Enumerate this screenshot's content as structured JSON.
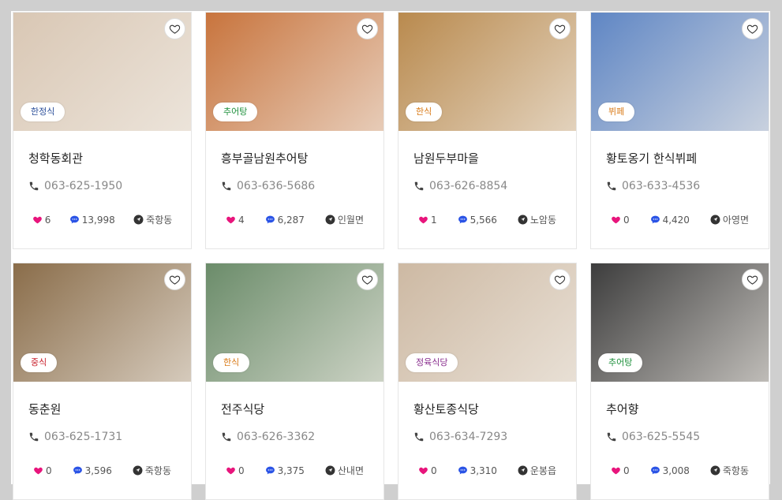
{
  "colors": {
    "heart": "#e8157c",
    "comment": "#2b54e6",
    "location": "#333333"
  },
  "icons": {
    "favorite": "heart-outline-icon",
    "phone": "phone-icon",
    "likes": "heart-icon",
    "comments": "chat-bubble-icon",
    "location": "location-arrow-icon"
  },
  "restaurants": [
    {
      "name": "청학동회관",
      "category": "한정식",
      "category_color": "#2c4f9a",
      "phone": "063-625-1950",
      "likes": "6",
      "comments": "13,998",
      "location": "죽항동",
      "thumb_bg": "#d9c7b4"
    },
    {
      "name": "흥부골남원추어탕",
      "category": "추어탕",
      "category_color": "#1c8f3a",
      "phone": "063-636-5686",
      "likes": "4",
      "comments": "6,287",
      "location": "인월면",
      "thumb_bg": "#c8743d"
    },
    {
      "name": "남원두부마을",
      "category": "한식",
      "category_color": "#d97a17",
      "phone": "063-626-8854",
      "likes": "1",
      "comments": "5,566",
      "location": "노암동",
      "thumb_bg": "#b98a4e"
    },
    {
      "name": "황토옹기 한식뷔페",
      "category": "뷔페",
      "category_color": "#d97a17",
      "phone": "063-633-4536",
      "likes": "0",
      "comments": "4,420",
      "location": "아영면",
      "thumb_bg": "#5f86c4"
    },
    {
      "name": "동춘원",
      "category": "중식",
      "category_color": "#c8202b",
      "phone": "063-625-1731",
      "likes": "0",
      "comments": "3,596",
      "location": "죽항동",
      "thumb_bg": "#8a6d4a"
    },
    {
      "name": "전주식당",
      "category": "한식",
      "category_color": "#d97a17",
      "phone": "063-626-3362",
      "likes": "0",
      "comments": "3,375",
      "location": "산내면",
      "thumb_bg": "#6b8c6a"
    },
    {
      "name": "황산토종식당",
      "category": "정육식당",
      "category_color": "#8a2f8f",
      "phone": "063-634-7293",
      "likes": "0",
      "comments": "3,310",
      "location": "운봉읍",
      "thumb_bg": "#cdb9a3"
    },
    {
      "name": "추어향",
      "category": "추어탕",
      "category_color": "#1c8f3a",
      "phone": "063-625-5545",
      "likes": "0",
      "comments": "3,008",
      "location": "죽항동",
      "thumb_bg": "#3d3d3d"
    }
  ]
}
